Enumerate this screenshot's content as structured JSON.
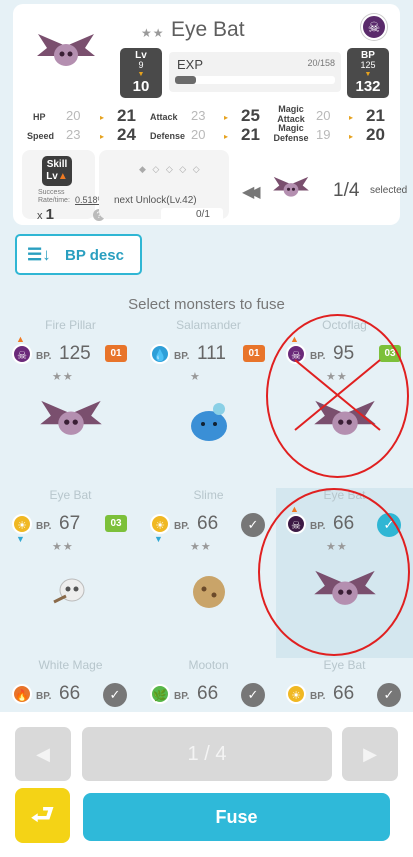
{
  "header": {
    "monster_name": "Eye Bat",
    "rarity_stars": "★★",
    "lv": {
      "tag": "Lv",
      "from": "9",
      "to": "10"
    },
    "bp": {
      "tag": "BP",
      "from": "125",
      "to": "132"
    },
    "exp": {
      "label": "EXP",
      "value": "20/158",
      "progress": 0.13
    },
    "stats": {
      "hp": {
        "label": "HP",
        "old": "20",
        "new": "21"
      },
      "attack": {
        "label": "Attack",
        "old": "23",
        "new": "25"
      },
      "magic_attack": {
        "label": "Magic Attack",
        "old": "20",
        "new": "21"
      },
      "speed": {
        "label": "Speed",
        "old": "23",
        "new": "24"
      },
      "defense": {
        "label": "Defense",
        "old": "20",
        "new": "21"
      },
      "magic_defense": {
        "label": "Magic Defense",
        "old": "19",
        "new": "20"
      }
    },
    "skill": {
      "badge_top": "Skill",
      "badge_bottom": "Lv",
      "rate_label": "Success Rate/time:",
      "rate_value": "0.518%",
      "multiplier_prefix": "x",
      "multiplier": "1",
      "help": "?"
    },
    "unlock": {
      "label": "next Unlock(Lv.42)",
      "value": "0/1",
      "gems": "◆ ◇ ◇ ◇ ◇"
    },
    "selection": {
      "count": "1/4",
      "label": "selected"
    }
  },
  "sort": {
    "label": "BP desc"
  },
  "section_title": "Select monsters to fuse",
  "monsters": [
    {
      "name": "Fire Pillar",
      "bp_label": "BP.",
      "bp": "125",
      "stars": "★★",
      "tag": "01",
      "tag_color": "#e8742a",
      "elem_color": "#6b2a7a",
      "elem_icon": "☠",
      "checked": false
    },
    {
      "name": "Salamander",
      "bp_label": "BP.",
      "bp": "111",
      "stars": "★",
      "tag": "01",
      "tag_color": "#e8742a",
      "elem_color": "#2f9fd8",
      "elem_icon": "💧",
      "checked": false
    },
    {
      "name": "Octoflag",
      "bp_label": "BP.",
      "bp": "95",
      "stars": "★★",
      "tag": "03",
      "tag_color": "#7cc03a",
      "elem_color": "#6b2a7a",
      "elem_icon": "☠",
      "checked": false
    },
    {
      "name": "Eye Bat",
      "bp_label": "BP.",
      "bp": "67",
      "stars": "★★",
      "tag": "03",
      "tag_color": "#7cc03a",
      "elem_color": "#f0b823",
      "elem_icon": "☀",
      "checked": false
    },
    {
      "name": "Slime",
      "bp_label": "BP.",
      "bp": "66",
      "stars": "★★",
      "tag": "✓",
      "tag_color": "#777777",
      "elem_color": "#f0b823",
      "elem_icon": "☀",
      "checked": true
    },
    {
      "name": "Eye Bat",
      "bp_label": "BP.",
      "bp": "66",
      "stars": "★★",
      "tag": "✓",
      "tag_color": "#2fb6d4",
      "elem_color": "#3d1a45",
      "elem_icon": "☠",
      "checked": true
    },
    {
      "name": "White Mage",
      "bp_label": "BP.",
      "bp": "66",
      "stars": "",
      "tag": "✓",
      "tag_color": "#777777",
      "elem_color": "#e8742a",
      "elem_icon": "🔥",
      "checked": true
    },
    {
      "name": "Mooton",
      "bp_label": "BP.",
      "bp": "66",
      "stars": "",
      "tag": "✓",
      "tag_color": "#777777",
      "elem_color": "#58b84a",
      "elem_icon": "🌿",
      "checked": true
    },
    {
      "name": "Eye Bat",
      "bp_label": "BP.",
      "bp": "66",
      "stars": "",
      "tag": "✓",
      "tag_color": "#777777",
      "elem_color": "#f0b823",
      "elem_icon": "☀",
      "checked": true
    }
  ],
  "pager": {
    "prev": "◀",
    "display": "1 / 4",
    "next": "▶"
  },
  "actions": {
    "back": "⮐",
    "fuse": "Fuse"
  },
  "colors": {
    "accent": "#2fb9d9",
    "back_button": "#f4d316",
    "annotation": "#e02020"
  }
}
